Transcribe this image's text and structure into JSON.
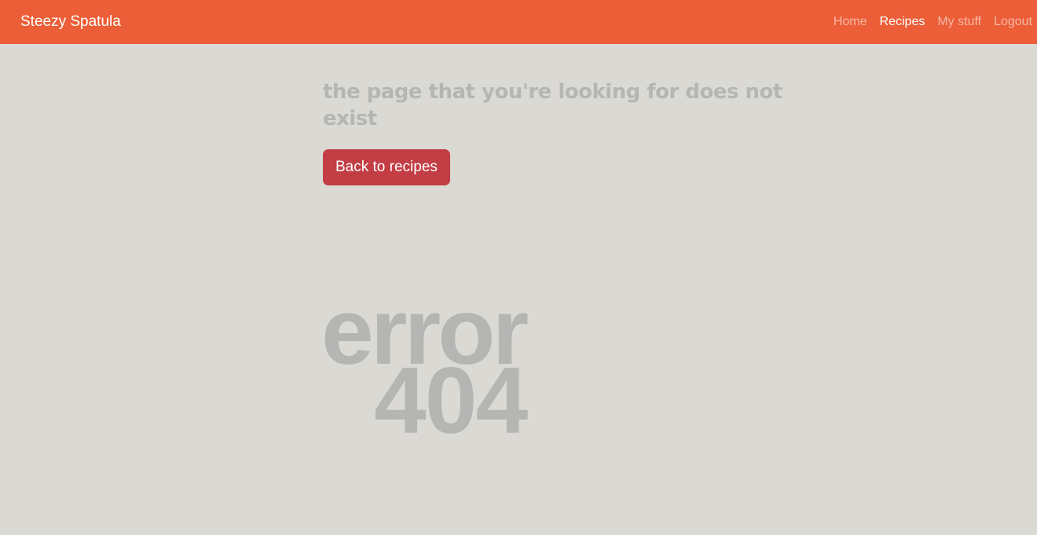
{
  "navbar": {
    "brand": "Steezy Spatula",
    "links": [
      {
        "label": "Home",
        "active": false
      },
      {
        "label": "Recipes",
        "active": true
      },
      {
        "label": "My stuff",
        "active": false
      },
      {
        "label": "Logout",
        "active": false
      }
    ],
    "background_color": "#eb5e37"
  },
  "main": {
    "message": "the page that you're looking for does not exist",
    "back_button_label": "Back to recipes",
    "button_color": "#c33d44",
    "error_word": "error",
    "error_code": "404"
  },
  "colors": {
    "page_background": "#dad9d4",
    "muted_text": "#b5b5b4"
  }
}
